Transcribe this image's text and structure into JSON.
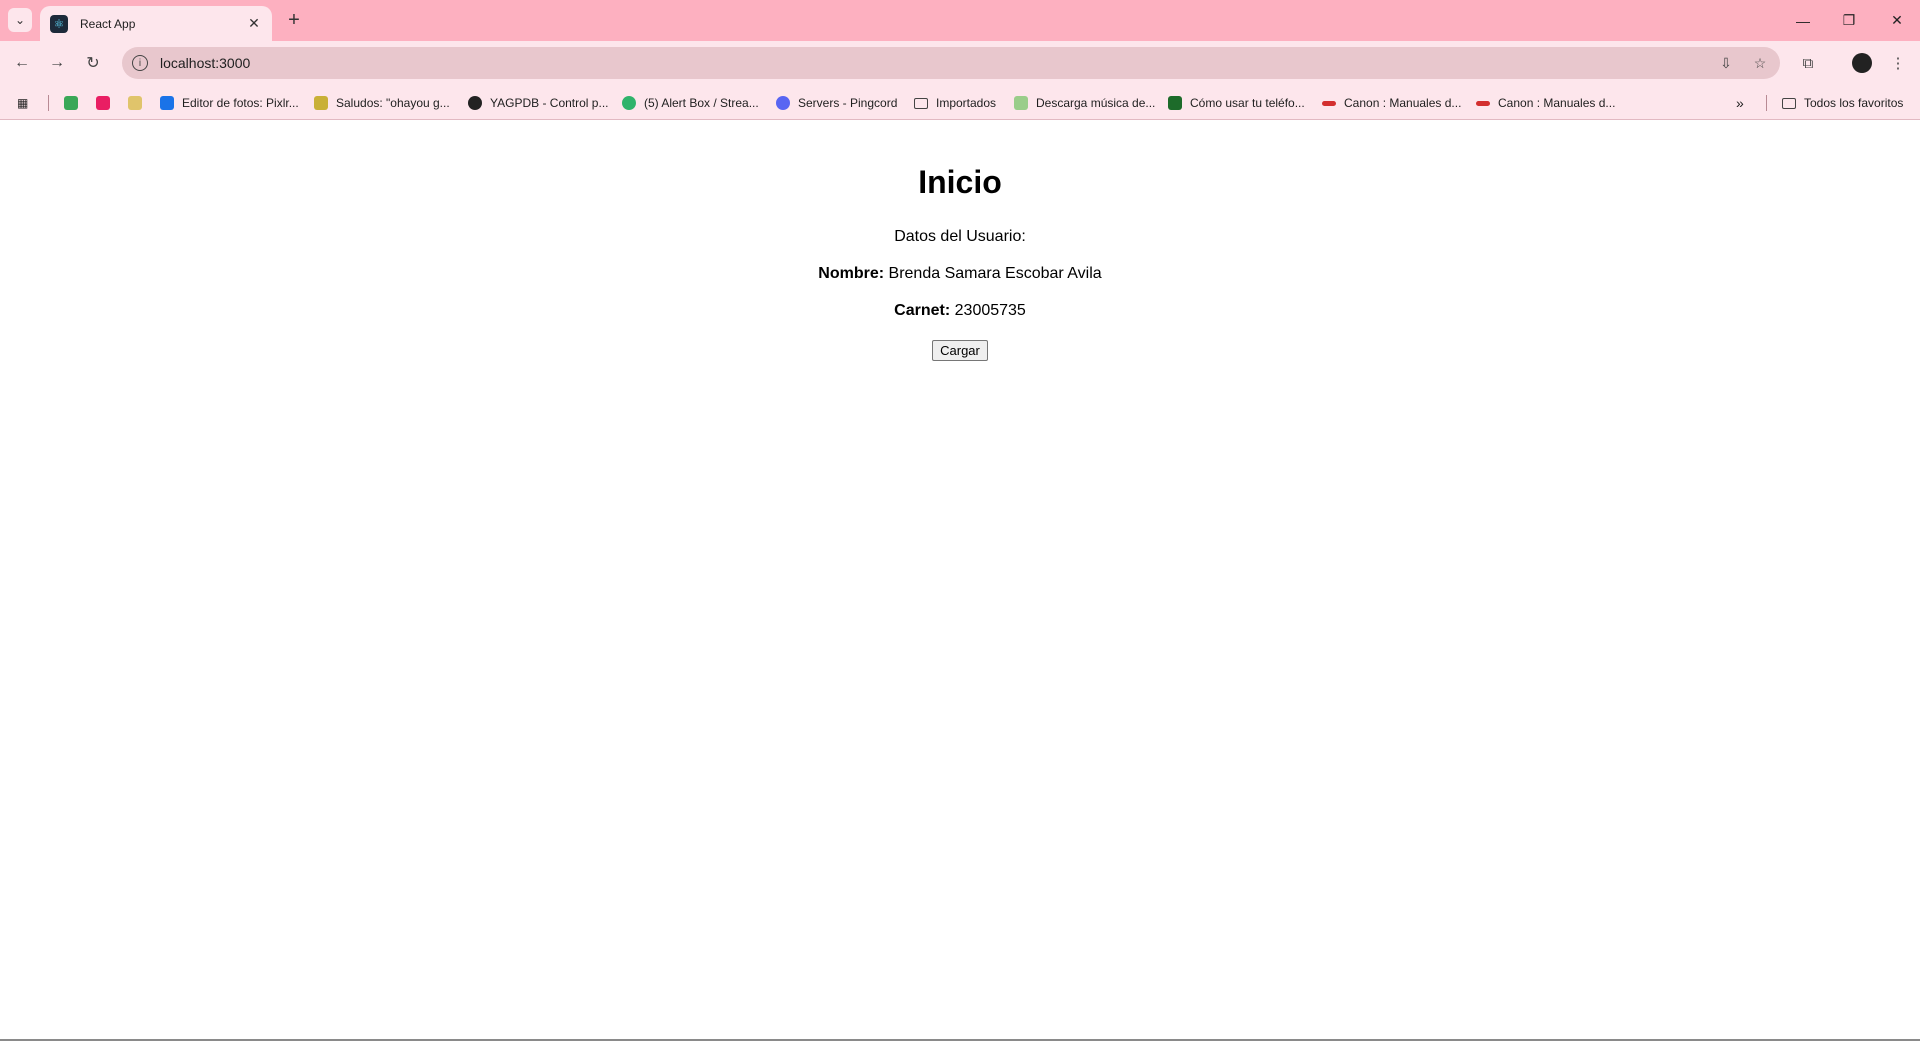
{
  "browser": {
    "tab": {
      "title": "React App"
    },
    "address_bar": {
      "url": "localhost:3000"
    },
    "bookmarks": [
      {
        "label": "Editor de fotos: Pixlr...",
        "color": "#1a73e8"
      },
      {
        "label": "Saludos: \"ohayou g...",
        "color": "#c9b037"
      },
      {
        "label": "YAGPDB - Control p...",
        "color": "#222222"
      },
      {
        "label": "(5) Alert Box / Strea...",
        "color": "#2fb36b"
      },
      {
        "label": "Servers - Pingcord",
        "color": "#5865f2"
      },
      {
        "label": "Importados",
        "color": "folder"
      },
      {
        "label": "Descarga música de...",
        "color": "#9acd8a"
      },
      {
        "label": "Cómo usar tu teléfo...",
        "color": "#1d6b2a"
      },
      {
        "label": "Canon : Manuales d...",
        "color": "#d32f2f"
      },
      {
        "label": "Canon : Manuales d...",
        "color": "#d32f2f"
      }
    ],
    "all_bookmarks_label": "Todos los favoritos"
  },
  "page": {
    "title": "Inicio",
    "subtitle": "Datos del Usuario:",
    "name_label": "Nombre:",
    "name_value": "Brenda Samara Escobar Avila",
    "carnet_label": "Carnet:",
    "carnet_value": "23005735",
    "button_label": "Cargar"
  },
  "colors": {
    "chrome_bg": "#fdb0c0",
    "toolbar_bg": "#fde6ec",
    "omnibox_bg": "#e8c7cd"
  }
}
